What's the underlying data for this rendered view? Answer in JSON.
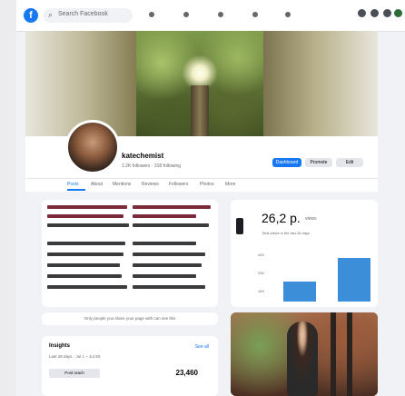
{
  "topbar": {
    "logo": "f",
    "search_placeholder": "Search Facebook",
    "icons": [
      "home-icon",
      "video-icon",
      "marketplace-icon",
      "groups-icon",
      "gaming-icon",
      "menu-icon"
    ]
  },
  "profile": {
    "name": "katechemist",
    "subline": "1.2K followers · 318 following",
    "buttons": {
      "primary": "Dashboard",
      "secondary": "Promote",
      "tertiary": "Edit"
    },
    "tabs": [
      "Posts",
      "About",
      "Mentions",
      "Reviews",
      "Followers",
      "Photos",
      "More"
    ]
  },
  "notice": {
    "text": "Only people you share your page with can see this"
  },
  "insights": {
    "title": "Insights",
    "link": "See all",
    "subtitle": "Last 28 days · Jul 1 – Jul 28",
    "label": "Post reach",
    "value": "23,460"
  },
  "stats": {
    "value": "26,2 p.",
    "unit": "views",
    "subtitle": "Total views in the last 28 days",
    "y_ticks": [
      "400",
      "200",
      "100"
    ]
  },
  "chart_data": {
    "type": "bar",
    "categories": [
      "",
      ""
    ],
    "values": [
      145,
      320
    ],
    "ylim": [
      0,
      400
    ]
  }
}
